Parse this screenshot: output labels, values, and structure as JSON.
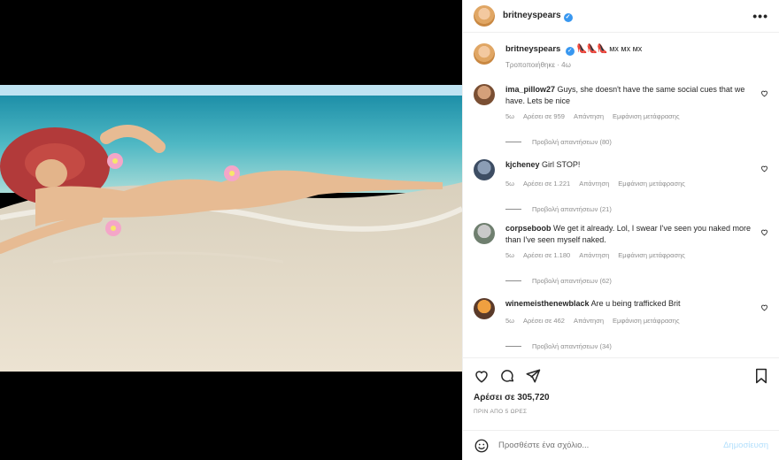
{
  "post": {
    "username": "britneyspears",
    "verified_mark": "✓",
    "more": "•••"
  },
  "caption": {
    "username": "britneyspears",
    "emoji": "👠👠👠",
    "text": "мx мx мx",
    "edited": "Τροποποιήθηκε · 4ω"
  },
  "comments": [
    {
      "username": "ima_pillow27",
      "text": "Guys, she doesn't have the same social cues that we have. Lets be nice",
      "age": "5ω",
      "likes": "Αρέσει σε 959",
      "reply": "Απάντηση",
      "translate": "Εμφάνιση μετάφρασης",
      "view_replies": "Προβολή απαντήσεων (80)"
    },
    {
      "username": "kjcheney",
      "text": "Girl STOP!",
      "age": "5ω",
      "likes": "Αρέσει σε 1.221",
      "reply": "Απάντηση",
      "translate": "Εμφάνιση μετάφρασης",
      "view_replies": "Προβολή απαντήσεων (21)"
    },
    {
      "username": "corpseboob",
      "text": "We get it already. Lol, I swear I've seen you naked more than I've seen myself naked.",
      "age": "5ω",
      "likes": "Αρέσει σε 1.180",
      "reply": "Απάντηση",
      "translate": "Εμφάνιση μετάφρασης",
      "view_replies": "Προβολή απαντήσεων (62)"
    },
    {
      "username": "winemeisthenewblack",
      "text": "Are u being trafficked Brit",
      "age": "5ω",
      "likes": "Αρέσει σε 462",
      "reply": "Απάντηση",
      "translate": "Εμφάνιση μετάφρασης",
      "view_replies": "Προβολή απαντήσεων (34)"
    }
  ],
  "footer": {
    "likes": "Αρέσει σε 305,720",
    "timestamp": "ΠΡΙΝ ΑΠΟ 5 ΩΡΕΣ",
    "comment_placeholder": "Προσθέστε ένα σχόλιο...",
    "post_button": "Δημοσίευση"
  },
  "colors": {
    "link_blue": "#3897f0",
    "muted_text": "#8e8e8e",
    "post_button_disabled": "#b2dffc"
  }
}
